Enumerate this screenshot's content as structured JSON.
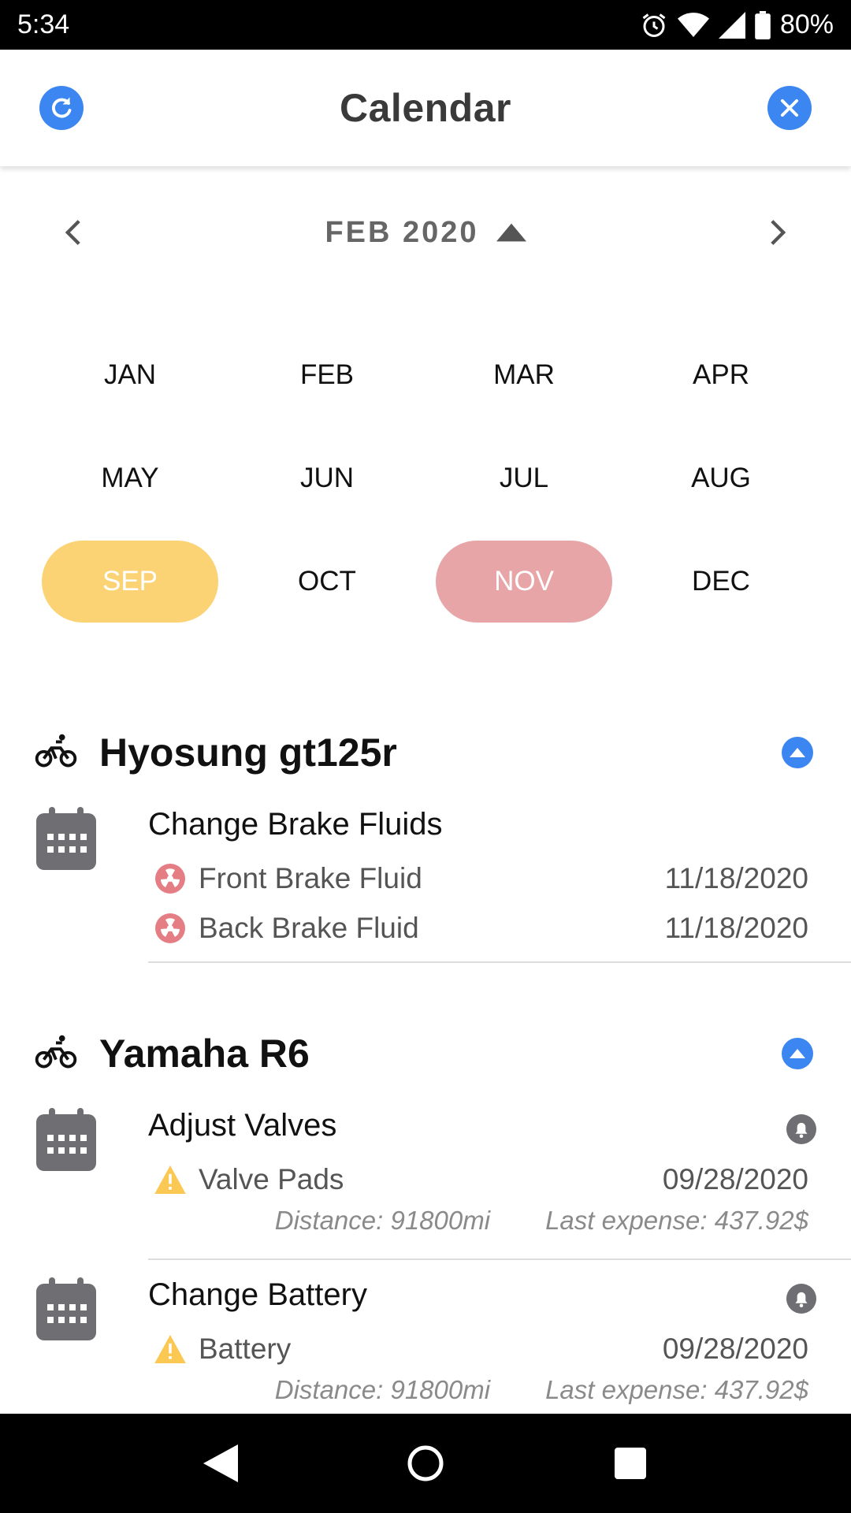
{
  "status_bar": {
    "time": "5:34",
    "battery": "80%"
  },
  "header": {
    "title": "Calendar",
    "refresh_icon": "refresh-icon",
    "close_icon": "close-icon",
    "accent": "#3b86f0"
  },
  "month_nav": {
    "label": "FEB 2020"
  },
  "months": [
    {
      "label": "JAN"
    },
    {
      "label": "FEB"
    },
    {
      "label": "MAR"
    },
    {
      "label": "APR"
    },
    {
      "label": "MAY"
    },
    {
      "label": "JUN"
    },
    {
      "label": "JUL"
    },
    {
      "label": "AUG"
    },
    {
      "label": "SEP",
      "highlight": "#fcd374"
    },
    {
      "label": "OCT"
    },
    {
      "label": "NOV",
      "highlight": "#e8a5a8"
    },
    {
      "label": "DEC"
    }
  ],
  "vehicles": [
    {
      "name": "Hyosung gt125r",
      "tasks": [
        {
          "title": "Change Brake Fluids",
          "parts": [
            {
              "name": "Front Brake Fluid",
              "date": "11/18/2020",
              "icon": "overdue-icon"
            },
            {
              "name": "Back Brake Fluid",
              "date": "11/18/2020",
              "icon": "overdue-icon"
            }
          ]
        }
      ]
    },
    {
      "name": "Yamaha R6",
      "tasks": [
        {
          "title": "Adjust Valves",
          "parts": [
            {
              "name": "Valve Pads",
              "date": "09/28/2020",
              "icon": "warning-icon"
            }
          ],
          "distance": "Distance: 91800mi",
          "last_expense": "Last expense: 437.92$"
        },
        {
          "title": "Change Battery",
          "parts": [
            {
              "name": "Battery",
              "date": "09/28/2020",
              "icon": "warning-icon"
            }
          ],
          "distance": "Distance: 91800mi",
          "last_expense": "Last expense: 437.92$"
        }
      ]
    }
  ],
  "colors": {
    "accent": "#3b86f0",
    "overdue": "#e57e84",
    "warning": "#fbc953",
    "icon_gray": "#6f6f73"
  }
}
